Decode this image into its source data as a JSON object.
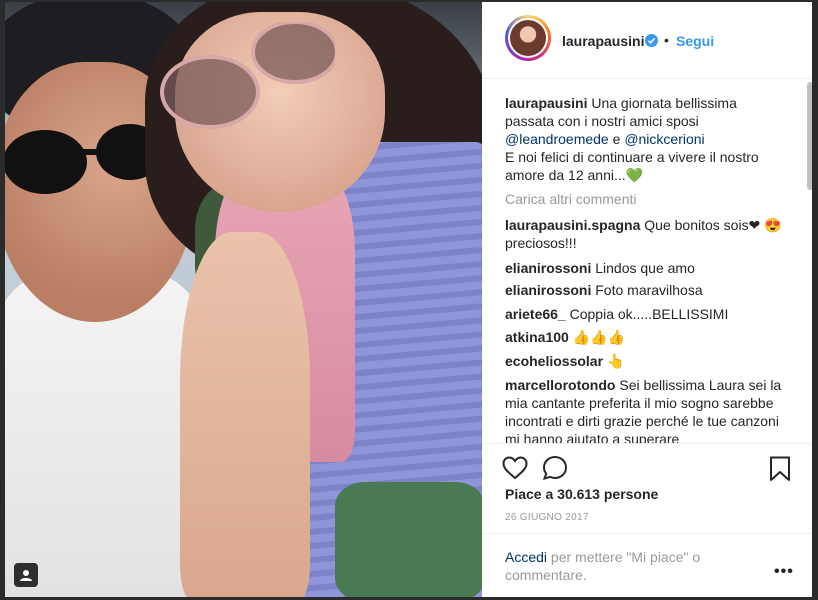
{
  "post": {
    "username": "laurapausini",
    "separator": "•",
    "follow_label": "Segui",
    "caption_user": "laurapausini",
    "caption_text_1": "Una giornata bellissima passata con i nostri amici sposi",
    "mention_1": "@leandroemede",
    "caption_and": "e",
    "mention_2": "@nickcerioni",
    "caption_text_2": "E noi felici di continuare a vivere il nostro amore da 12 anni...💚",
    "load_more": "Carica altri commenti",
    "comments": [
      {
        "user": "laurapausini.spagna",
        "text": "Que bonitos sois❤ 😍 preciosos!!!"
      },
      {
        "user": "elianirossoni",
        "text": "Lindos que amo"
      },
      {
        "user": "elianirossoni",
        "text": "Foto maravilhosa"
      },
      {
        "user": "ariete66_",
        "text": "Coppia ok.....BELLISSIMI"
      },
      {
        "user": "atkina100",
        "text": "👍👍👍"
      },
      {
        "user": "ecoheliossolar",
        "text": "👆"
      },
      {
        "user": "marcellorotondo",
        "text": "Sei bellissima Laura sei la mia cantante preferita il mio sogno sarebbe incontrati e dirti grazie perché le tue canzoni mi hanno aiutato a superare"
      }
    ],
    "likes": "Piace a 30.613 persone",
    "date": "26 GIUGNO 2017",
    "login_link": "Accedi",
    "login_text": "per mettere \"Mi piace\" o commentare.",
    "more_label": "•••"
  },
  "icons": {
    "verified": "verified-badge-icon",
    "heart": "heart-icon",
    "comment": "comment-icon",
    "bookmark": "bookmark-icon",
    "tag": "user-tag-icon"
  },
  "colors": {
    "link_blue": "#3897f0",
    "mention_blue": "#003569",
    "muted": "#999999"
  }
}
